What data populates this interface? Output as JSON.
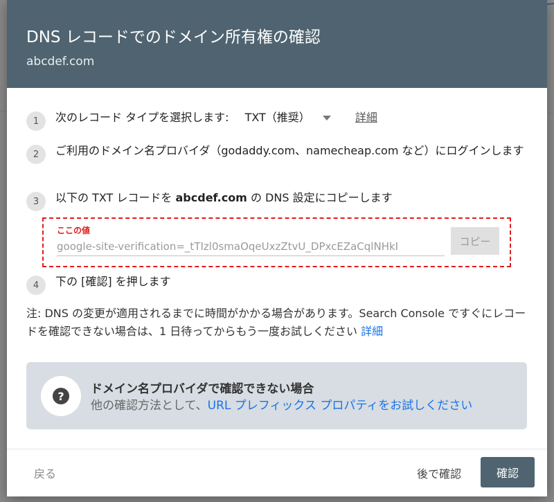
{
  "dialog": {
    "title": "DNS レコードでのドメイン所有権の確認",
    "domain": "abcdef.com"
  },
  "steps": {
    "s1": {
      "num": "1",
      "text": "次のレコード タイプを選択します:",
      "record_type": "TXT（推奨）",
      "detail_link": "詳細"
    },
    "s2": {
      "num": "2",
      "text": "ご利用のドメイン名プロバイダ（godaddy.com、namecheap.com など）にログインします"
    },
    "s3": {
      "num": "3",
      "text_before": "以下の TXT レコードを ",
      "domain": "abcdef.com",
      "text_after": " の DNS 設定にコピーします"
    },
    "s4": {
      "num": "4",
      "text": "下の [確認] を押します"
    }
  },
  "txt_record": {
    "annotation": "ここの値",
    "value": "google-site-verification=_tTIzl0smaOqeUxzZtvU_DPxcEZaCqlNHkI",
    "copy_label": "コピー"
  },
  "note": {
    "text": "注: DNS の変更が適用されるまでに時間がかかる場合があります。Search Console ですぐにレコードを確認できない場合は、1 日待ってからもう一度お試しください ",
    "link": "詳細"
  },
  "help_box": {
    "icon": "help-icon",
    "title": "ドメイン名プロバイダで確認できない場合",
    "text": "他の確認方法として、",
    "link": "URL プレフィックス プロパティをお試しください"
  },
  "footer": {
    "back_label": "戻る",
    "later_label": "後で確認",
    "verify_label": "確認"
  },
  "colors": {
    "header_bg": "#4f6470",
    "annotation_red": "#e21b1b",
    "link_blue": "#1a73e8",
    "help_box_bg": "#d7dde3"
  }
}
